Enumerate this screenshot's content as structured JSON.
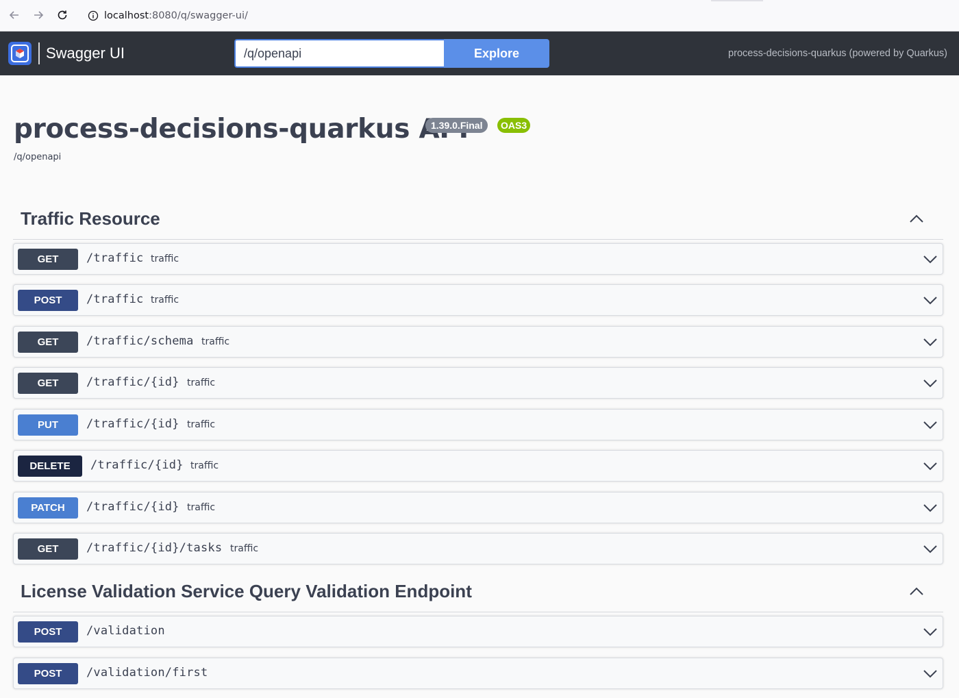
{
  "browser": {
    "url_host": "localhost",
    "url_path": ":8080/q/swagger-ui/"
  },
  "topbar": {
    "brand": "Swagger UI",
    "search_value": "/q/openapi",
    "explore_label": "Explore",
    "powered_by": "process-decisions-quarkus (powered by Quarkus)"
  },
  "info": {
    "title": "process-decisions-quarkus API",
    "version": "1.39.0.Final",
    "oas": "OAS3",
    "url": "/q/openapi"
  },
  "sections": [
    {
      "title": "Traffic Resource",
      "operations": [
        {
          "method": "GET",
          "path": "/traffic",
          "tag": "traffic"
        },
        {
          "method": "POST",
          "path": "/traffic",
          "tag": "traffic"
        },
        {
          "method": "GET",
          "path": "/traffic/schema",
          "tag": "traffic"
        },
        {
          "method": "GET",
          "path": "/traffic/{id}",
          "tag": "traffic"
        },
        {
          "method": "PUT",
          "path": "/traffic/{id}",
          "tag": "traffic"
        },
        {
          "method": "DELETE",
          "path": "/traffic/{id}",
          "tag": "traffic"
        },
        {
          "method": "PATCH",
          "path": "/traffic/{id}",
          "tag": "traffic"
        },
        {
          "method": "GET",
          "path": "/traffic/{id}/tasks",
          "tag": "traffic"
        }
      ]
    },
    {
      "title": "License Validation Service Query Validation Endpoint",
      "operations": [
        {
          "method": "POST",
          "path": "/validation",
          "tag": ""
        },
        {
          "method": "POST",
          "path": "/validation/first",
          "tag": ""
        }
      ]
    }
  ],
  "colors": {
    "get": "#3c4658",
    "post": "#344b87",
    "put": "#4a7fd1",
    "delete": "#1b2541",
    "patch": "#4a7fd1",
    "topbar": "#2f333a",
    "oas_badge": "#89bf04"
  }
}
